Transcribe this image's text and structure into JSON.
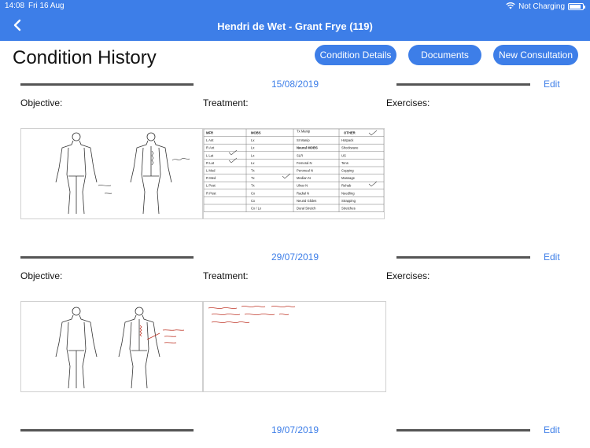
{
  "status_bar": {
    "time": "14:08",
    "date": "Fri 16 Aug",
    "charging": "Not Charging",
    "battery_level": 0.9
  },
  "nav": {
    "title": "Hendri de Wet - Grant Frye (119)"
  },
  "page": {
    "title": "Condition History"
  },
  "actions": {
    "condition_details": "Condition Details",
    "documents": "Documents",
    "new_consultation": "New Consultation"
  },
  "entries": [
    {
      "date": "15/08/2019",
      "edit": "Edit",
      "objective": "Objective:",
      "treatment": "Treatment:",
      "exercises": "Exercises:"
    },
    {
      "date": "29/07/2019",
      "edit": "Edit",
      "objective": "Objective:",
      "treatment": "Treatment:",
      "exercises": "Exercises:"
    },
    {
      "date": "19/07/2019",
      "edit": "Edit"
    }
  ],
  "treatment_form": {
    "headers": [
      "MFR",
      "MOBS",
      "Tx Manip",
      "OTHER"
    ],
    "mfr": [
      "L Ant",
      "R Ant",
      "L Lat",
      "R Lat",
      "L Med",
      "R Med",
      "L Post",
      "R Post"
    ],
    "mobs": [
      "Lx",
      "Lx",
      "Lx",
      "Lx",
      "Tx",
      "Tx",
      "Tx",
      "Cx",
      "Cx",
      "Cx / Lx"
    ],
    "manip": [
      "SI Manip",
      "Neural MOBS",
      "SLR",
      "Femoral N",
      "Peroneal N",
      "Median N",
      "Ulnar N",
      "Radial N",
      "Neural Glides",
      "Dural Stretch"
    ],
    "other": [
      "Hotpack",
      "Shockwave",
      "US",
      "Tens",
      "Cupping",
      "Massage",
      "Rehab",
      "Needling",
      "Strapping",
      "Stretches"
    ]
  }
}
